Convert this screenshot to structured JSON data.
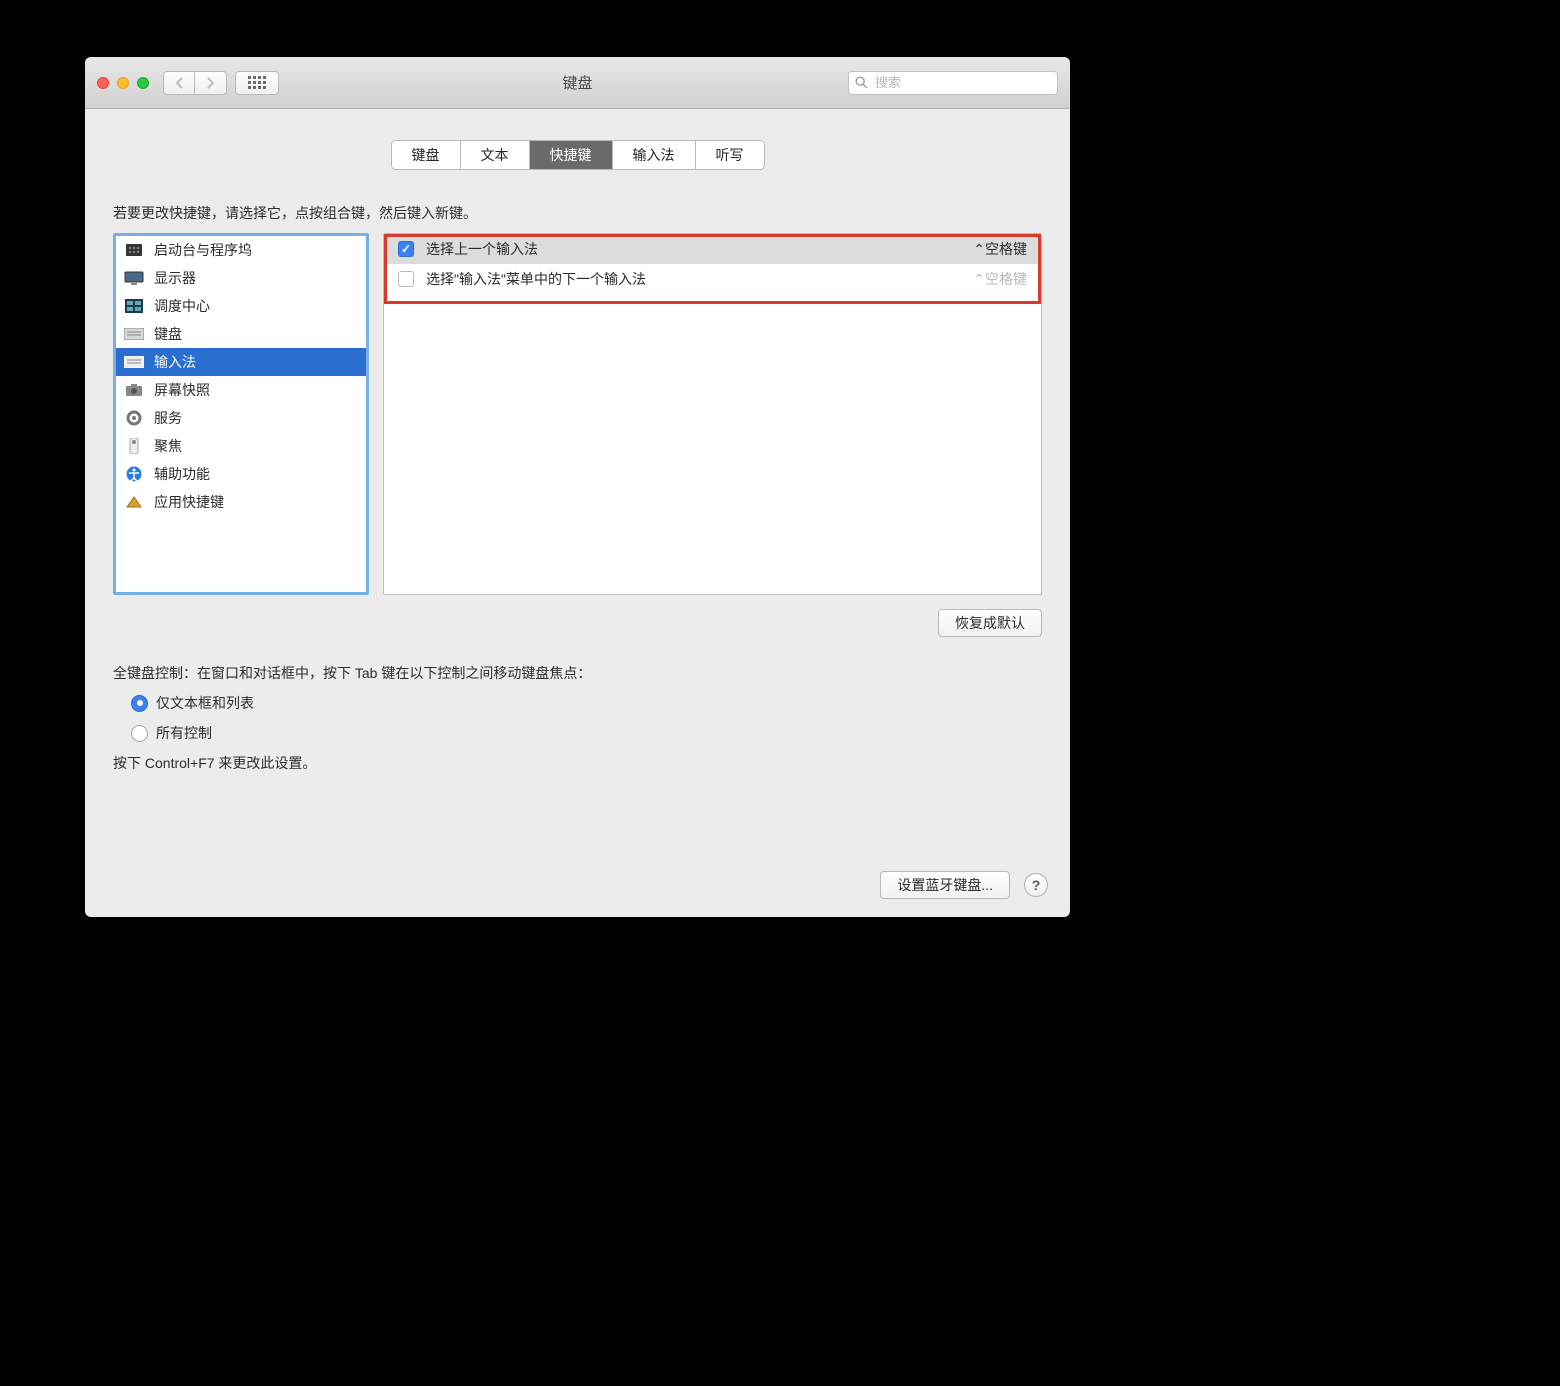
{
  "window": {
    "title": "键盘"
  },
  "search": {
    "placeholder": "搜索"
  },
  "tabs": [
    "键盘",
    "文本",
    "快捷键",
    "输入法",
    "听写"
  ],
  "active_tab_index": 2,
  "instructions": "若要更改快捷键，请选择它，点按组合键，然后键入新键。",
  "categories": [
    {
      "label": "启动台与程序坞",
      "icon": "launchpad"
    },
    {
      "label": "显示器",
      "icon": "display"
    },
    {
      "label": "调度中心",
      "icon": "mission"
    },
    {
      "label": "键盘",
      "icon": "keyboard"
    },
    {
      "label": "输入法",
      "icon": "keyboard",
      "selected": true
    },
    {
      "label": "屏幕快照",
      "icon": "camera"
    },
    {
      "label": "服务",
      "icon": "gear"
    },
    {
      "label": "聚焦",
      "icon": "spotlight"
    },
    {
      "label": "辅助功能",
      "icon": "accessibility"
    },
    {
      "label": "应用快捷键",
      "icon": "apps"
    }
  ],
  "shortcuts": [
    {
      "checked": true,
      "label": "选择上一个输入法",
      "key": "⌃空格键",
      "selected": true,
      "dim": false
    },
    {
      "checked": false,
      "label": "选择\"输入法\"菜单中的下一个输入法",
      "key": "⌃空格键",
      "selected": false,
      "dim": true
    }
  ],
  "restore_label": "恢复成默认",
  "kb_control": {
    "heading": "全键盘控制：在窗口和对话框中，按下 Tab 键在以下控制之间移动键盘焦点：",
    "opt1": "仅文本框和列表",
    "opt2": "所有控制",
    "hint": "按下 Control+F7 来更改此设置。"
  },
  "footer": {
    "bluetooth": "设置蓝牙键盘...",
    "help": "?"
  }
}
